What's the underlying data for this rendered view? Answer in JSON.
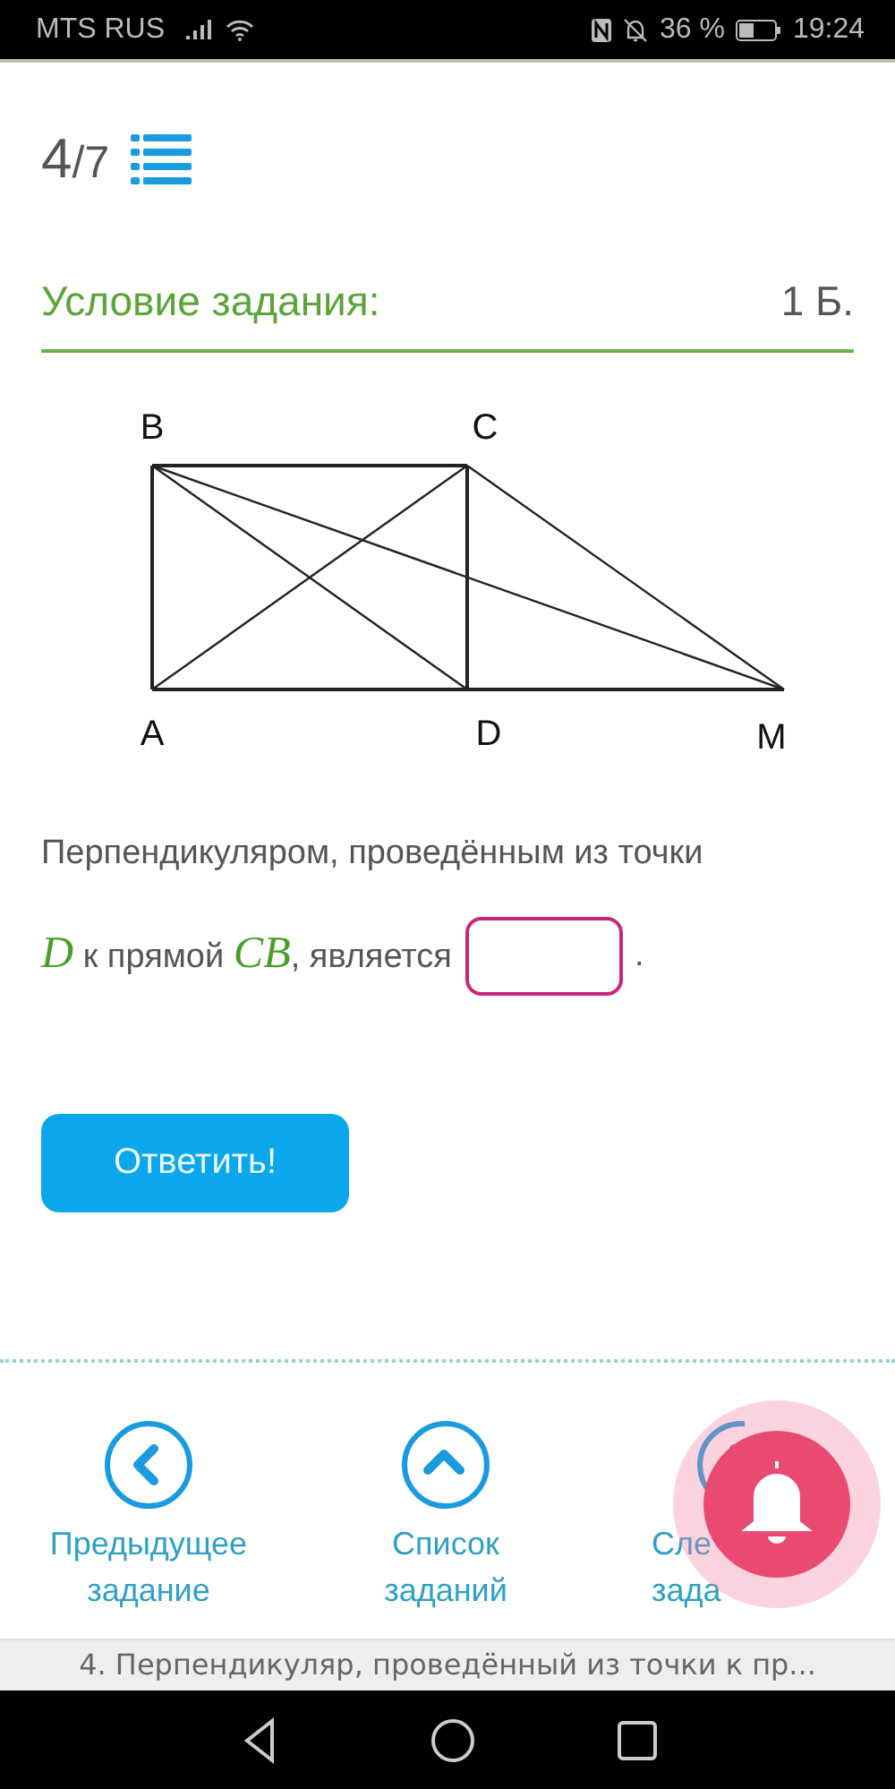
{
  "status_bar": {
    "carrier": "MTS RUS",
    "battery": "36 %",
    "time": "19:24"
  },
  "counter": {
    "current": "4",
    "total": "/7"
  },
  "section": {
    "title": "Условие задания:",
    "points": "1 Б."
  },
  "figure": {
    "points": [
      {
        "label": "B"
      },
      {
        "label": "C"
      },
      {
        "label": "A"
      },
      {
        "label": "D"
      },
      {
        "label": "M"
      }
    ]
  },
  "question": {
    "line_1": "Перпендикуляром, проведённым из точки",
    "line_2": "*D* к прямой *CB*, является",
    "after": "."
  },
  "submit_button": "Ответить!",
  "nav": [
    {
      "kind": "prev",
      "lines": [
        "Предыдущее",
        "задание"
      ]
    },
    {
      "kind": "list",
      "lines": [
        "Список",
        "заданий"
      ]
    },
    {
      "kind": "next",
      "lines": [
        "Сле",
        "зада"
      ]
    }
  ],
  "footer_title": "4. Перпендикуляр, проведённый из точки к пр..."
}
